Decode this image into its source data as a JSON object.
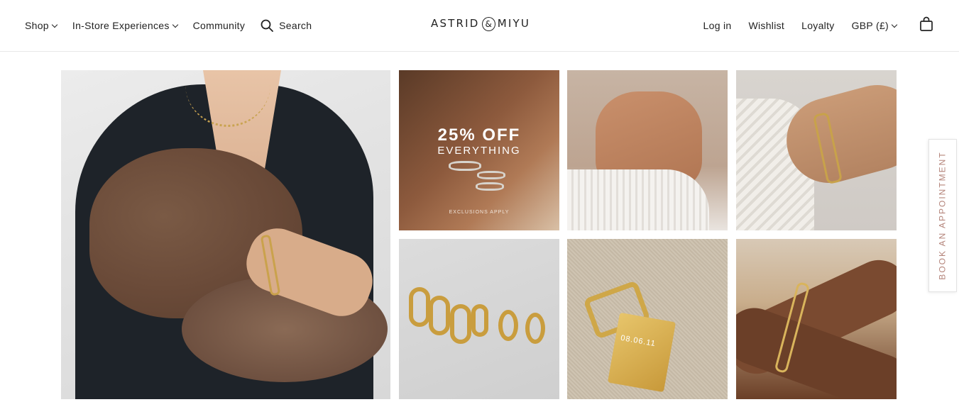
{
  "header": {
    "nav_left": {
      "shop": "Shop",
      "in_store": "In-Store Experiences",
      "community": "Community",
      "search": "Search"
    },
    "logo": {
      "left": "ASTRID",
      "amp": "&",
      "right": "MIYU"
    },
    "nav_right": {
      "login": "Log in",
      "wishlist": "Wishlist",
      "loyalty": "Loyalty",
      "currency": "GBP (£)"
    }
  },
  "grid": {
    "promo_tile": {
      "headline": "25% OFF",
      "subline": "EVERYTHING",
      "note": "EXCLUSIONS APPLY"
    },
    "pendant_engraving": "08.06.11"
  },
  "side_tab": {
    "label": "BOOK AN APPOINTMENT"
  },
  "colors": {
    "text": "#222222",
    "accent": "#b4847a",
    "gold": "#c9a24a"
  }
}
